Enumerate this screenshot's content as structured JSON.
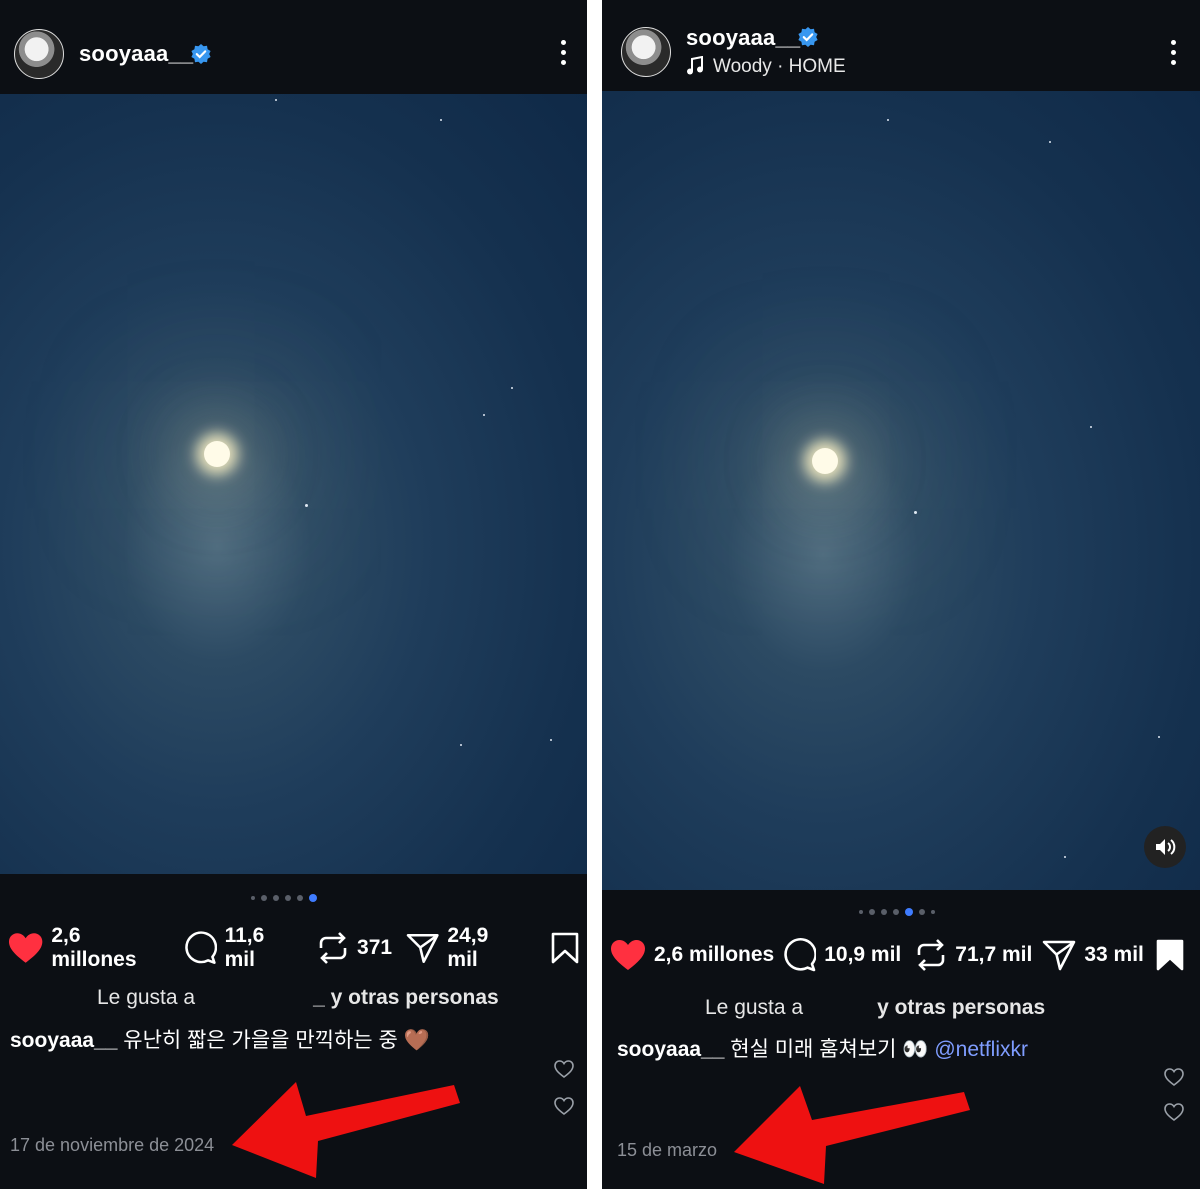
{
  "left_post": {
    "username": "sooyaaa__",
    "page_indicator": {
      "count": 6,
      "active_index": 5
    },
    "actions": {
      "likes": "2,6 millones",
      "comments": "11,6 mil",
      "reposts": "371",
      "shares": "24,9 mil"
    },
    "liked_by_prefix": "Le gusta a",
    "liked_by_suffix": "_ y otras personas",
    "caption_user": "sooyaaa__",
    "caption_text": "유난히 짧은 가을을 만끽하는 중 🤎",
    "date": "17 de noviembre de 2024"
  },
  "right_post": {
    "username": "sooyaaa__",
    "music": "Woody · HOME",
    "page_indicator": {
      "count": 7,
      "active_index": 4
    },
    "actions": {
      "likes": "2,6 millones",
      "comments": "10,9 mil",
      "reposts": "71,7 mil",
      "shares": "33 mil"
    },
    "liked_by_prefix": "Le gusta a",
    "liked_by_suffix": "y otras personas",
    "caption_user": "sooyaaa__",
    "caption_text": "현실 미래 훔쳐보기 👀",
    "caption_mention": "@netflixkr",
    "date": "15 de marzo"
  },
  "colors": {
    "background": "#0c0f14",
    "heart": "#ff3040",
    "verified": "#3897f0",
    "arrow": "#ee1111",
    "mention": "#7f9dff"
  },
  "icons": [
    "verified-badge-icon",
    "more-options-icon",
    "music-note-icon",
    "heart-icon",
    "comment-icon",
    "repost-icon",
    "share-icon",
    "bookmark-icon",
    "speaker-icon"
  ]
}
